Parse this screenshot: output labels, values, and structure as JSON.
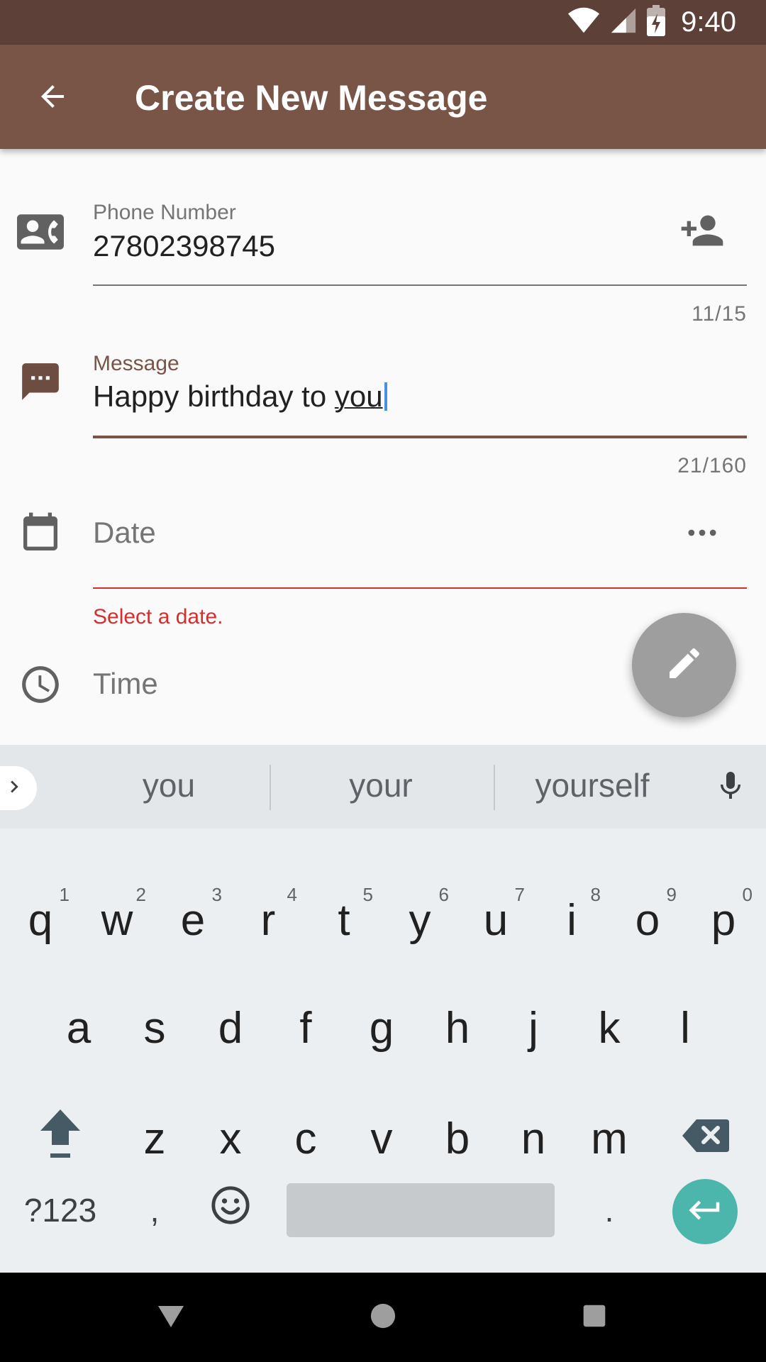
{
  "status_bar": {
    "time": "9:40"
  },
  "app_bar": {
    "title": "Create New Message"
  },
  "form": {
    "phone": {
      "label": "Phone Number",
      "value": "27802398745",
      "counter": "11/15"
    },
    "message": {
      "label": "Message",
      "value_prefix": "Happy birthday to ",
      "value_suggest": "you",
      "counter": "21/160"
    },
    "date": {
      "placeholder": "Date",
      "error": "Select a date."
    },
    "time": {
      "placeholder": "Time"
    }
  },
  "colors": {
    "primary": "#795548",
    "primary_dark": "#5d4037",
    "error": "#d32f2f",
    "fab": "#9e9e9e",
    "enter_key": "#4db6ac"
  },
  "keyboard": {
    "suggestions": [
      "you",
      "your",
      "yourself"
    ],
    "row1": [
      {
        "k": "q",
        "h": "1"
      },
      {
        "k": "w",
        "h": "2"
      },
      {
        "k": "e",
        "h": "3"
      },
      {
        "k": "r",
        "h": "4"
      },
      {
        "k": "t",
        "h": "5"
      },
      {
        "k": "y",
        "h": "6"
      },
      {
        "k": "u",
        "h": "7"
      },
      {
        "k": "i",
        "h": "8"
      },
      {
        "k": "o",
        "h": "9"
      },
      {
        "k": "p",
        "h": "0"
      }
    ],
    "row2": [
      "a",
      "s",
      "d",
      "f",
      "g",
      "h",
      "j",
      "k",
      "l"
    ],
    "row3": [
      "z",
      "x",
      "c",
      "v",
      "b",
      "n",
      "m"
    ],
    "symbols_label": "?123",
    "comma": ",",
    "period": "."
  }
}
